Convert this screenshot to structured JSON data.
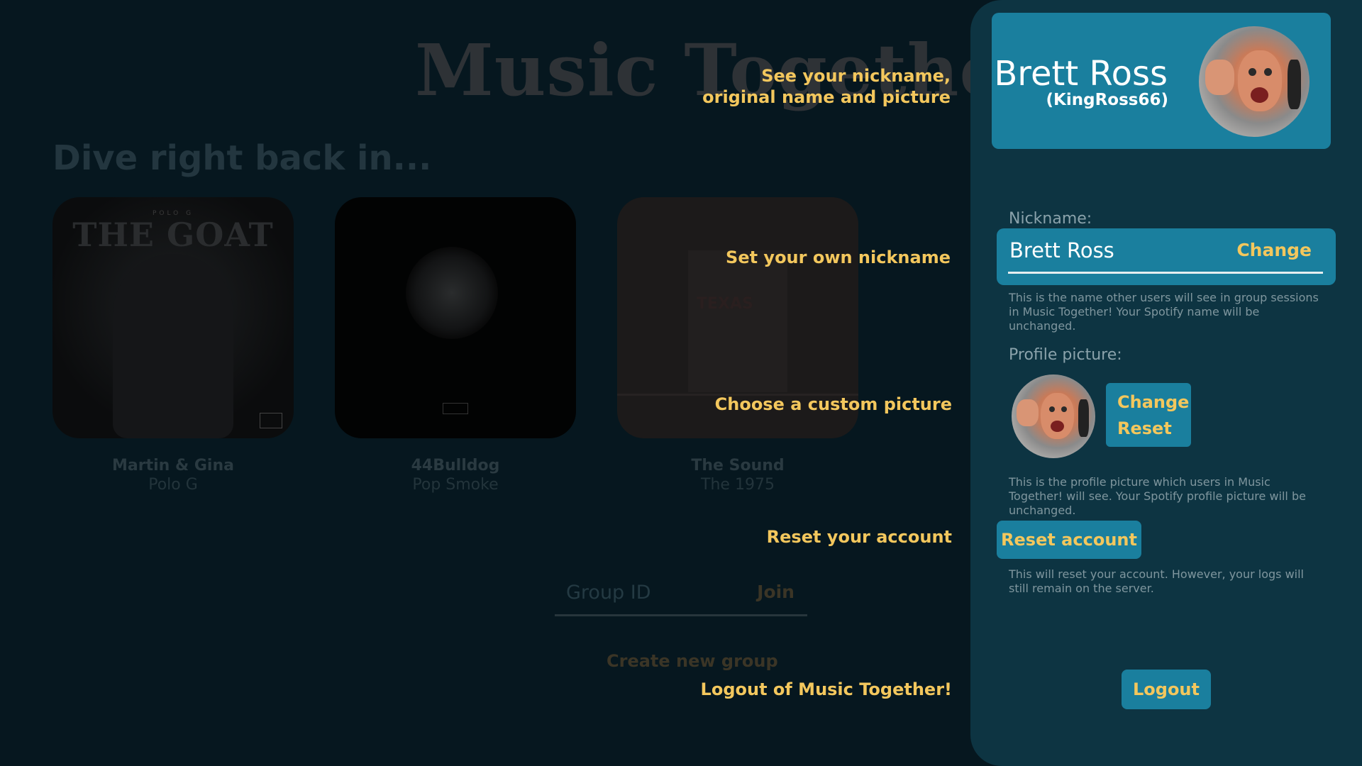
{
  "app": {
    "title": "Music Together!",
    "subtitle": "Dive right back in..."
  },
  "albums": [
    {
      "name": "Martin & Gina",
      "artist": "Polo G",
      "cover_text": "THE GOAT",
      "cover_small": "POLO G"
    },
    {
      "name": "44Bulldog",
      "artist": "Pop Smoke"
    },
    {
      "name": "The Sound",
      "artist": "The 1975",
      "cover_text": "TEXAS"
    }
  ],
  "group": {
    "placeholder": "Group ID",
    "join_label": "Join",
    "create_label": "Create new group"
  },
  "hints": {
    "identity": "See your nickname, original name and picture",
    "nickname": "Set your own nickname",
    "picture": "Choose a custom picture",
    "reset": "Reset your account",
    "logout": "Logout of Music Together!"
  },
  "profile": {
    "full_name": "Brett Ross",
    "handle": "(KingRoss66)",
    "nickname_label": "Nickname:",
    "nickname_value": "Brett Ross",
    "nickname_change": "Change",
    "nickname_help": "This is the name other users will see in group sessions in Music Together! Your Spotify name will be unchanged.",
    "picture_label": "Profile picture:",
    "picture_change": "Change",
    "picture_reset": "Reset",
    "picture_help": "This is the profile picture which users in Music Together! will see. Your Spotify profile picture will be unchanged.",
    "reset_account": "Reset account",
    "reset_help": "This will reset your account. However, your logs will still remain on the server.",
    "logout": "Logout"
  },
  "colors": {
    "background": "#06171f",
    "panel": "#0d3442",
    "accent": "#1a7f9e",
    "highlight": "#f3c75d"
  }
}
